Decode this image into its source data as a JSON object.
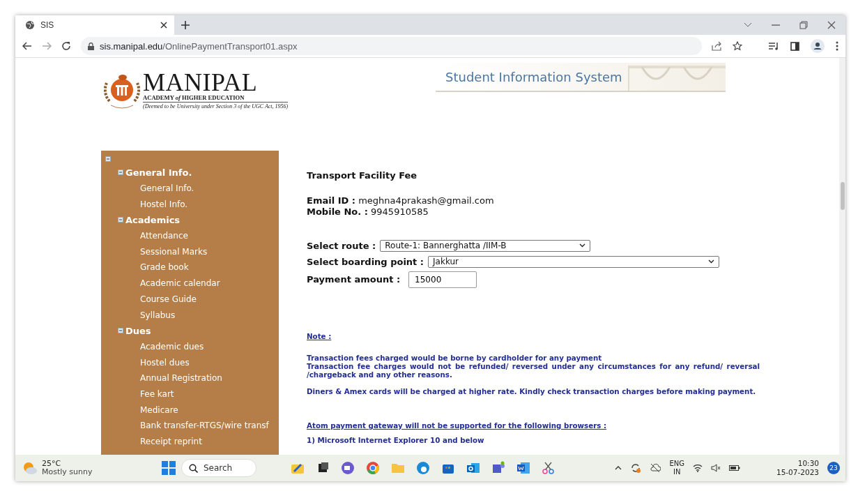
{
  "browser": {
    "tab_title": "SIS",
    "url_host": "sis.manipal.edu",
    "url_path": "/OnlinePaymentTransport01.aspx"
  },
  "logo": {
    "name": "MANIPAL",
    "subtitle": "ACADEMY *of* HIGHER EDUCATION",
    "tagline": "(Deemed to be University under Section 3 of the UGC Act, 1956)"
  },
  "header_title": "Student Information System",
  "sidebar": {
    "expanded": true,
    "children": [
      {
        "label": "General Info.",
        "expanded": true,
        "children": [
          {
            "label": "General Info."
          },
          {
            "label": "Hostel Info."
          }
        ]
      },
      {
        "label": "Academics",
        "expanded": true,
        "children": [
          {
            "label": "Attendance"
          },
          {
            "label": "Sessional Marks"
          },
          {
            "label": "Grade book"
          },
          {
            "label": "Academic calendar"
          },
          {
            "label": "Course Guide"
          },
          {
            "label": "Syllabus"
          }
        ]
      },
      {
        "label": "Dues",
        "expanded": true,
        "children": [
          {
            "label": "Academic dues"
          },
          {
            "label": "Hostel dues"
          },
          {
            "label": "Annual Registration"
          },
          {
            "label": "Fee kart"
          },
          {
            "label": "Medicare"
          },
          {
            "label": "Bank transfer-RTGS/wire transf"
          },
          {
            "label": "Receipt reprint"
          }
        ]
      }
    ]
  },
  "form": {
    "title": "Transport Facility Fee",
    "info": [
      {
        "label": "Email ID :",
        "value": "meghna4prakash@gmail.com"
      },
      {
        "label": "Mobile No. :",
        "value": "9945910585"
      }
    ],
    "fields": [
      {
        "kind": "select",
        "label": "Select route :",
        "value": "Route-1: Bannerghatta /IIM-B"
      },
      {
        "kind": "select",
        "label": "Select boarding point :",
        "value": "Jakkur"
      },
      {
        "kind": "input",
        "label": "Payment amount :",
        "value": "15000"
      }
    ]
  },
  "notes": {
    "heading": "Note :",
    "paragraphs": [
      [
        "Transaction fees charged would be borne by cardholder for any payment",
        "Transaction fee charges would not be refunded/ reversed under any circumstances for any refund/ reversal /chargeback and any other reasons."
      ],
      [
        "Diners & Amex cards will be charged at higher rate. Kindly check transaction charges before making payment."
      ]
    ],
    "browsers_heading": "Atom payment gateway will not be supported for the following browsers :",
    "browsers": [
      "1) Microsoft Internet Explorer 10 and below"
    ]
  },
  "taskbar": {
    "temperature": "25°C",
    "weather": "Mostly sunny",
    "search": "Search",
    "language": "ENG",
    "region": "IN",
    "time": "10:30",
    "date": "15-07-2023",
    "notification_count": "23"
  }
}
